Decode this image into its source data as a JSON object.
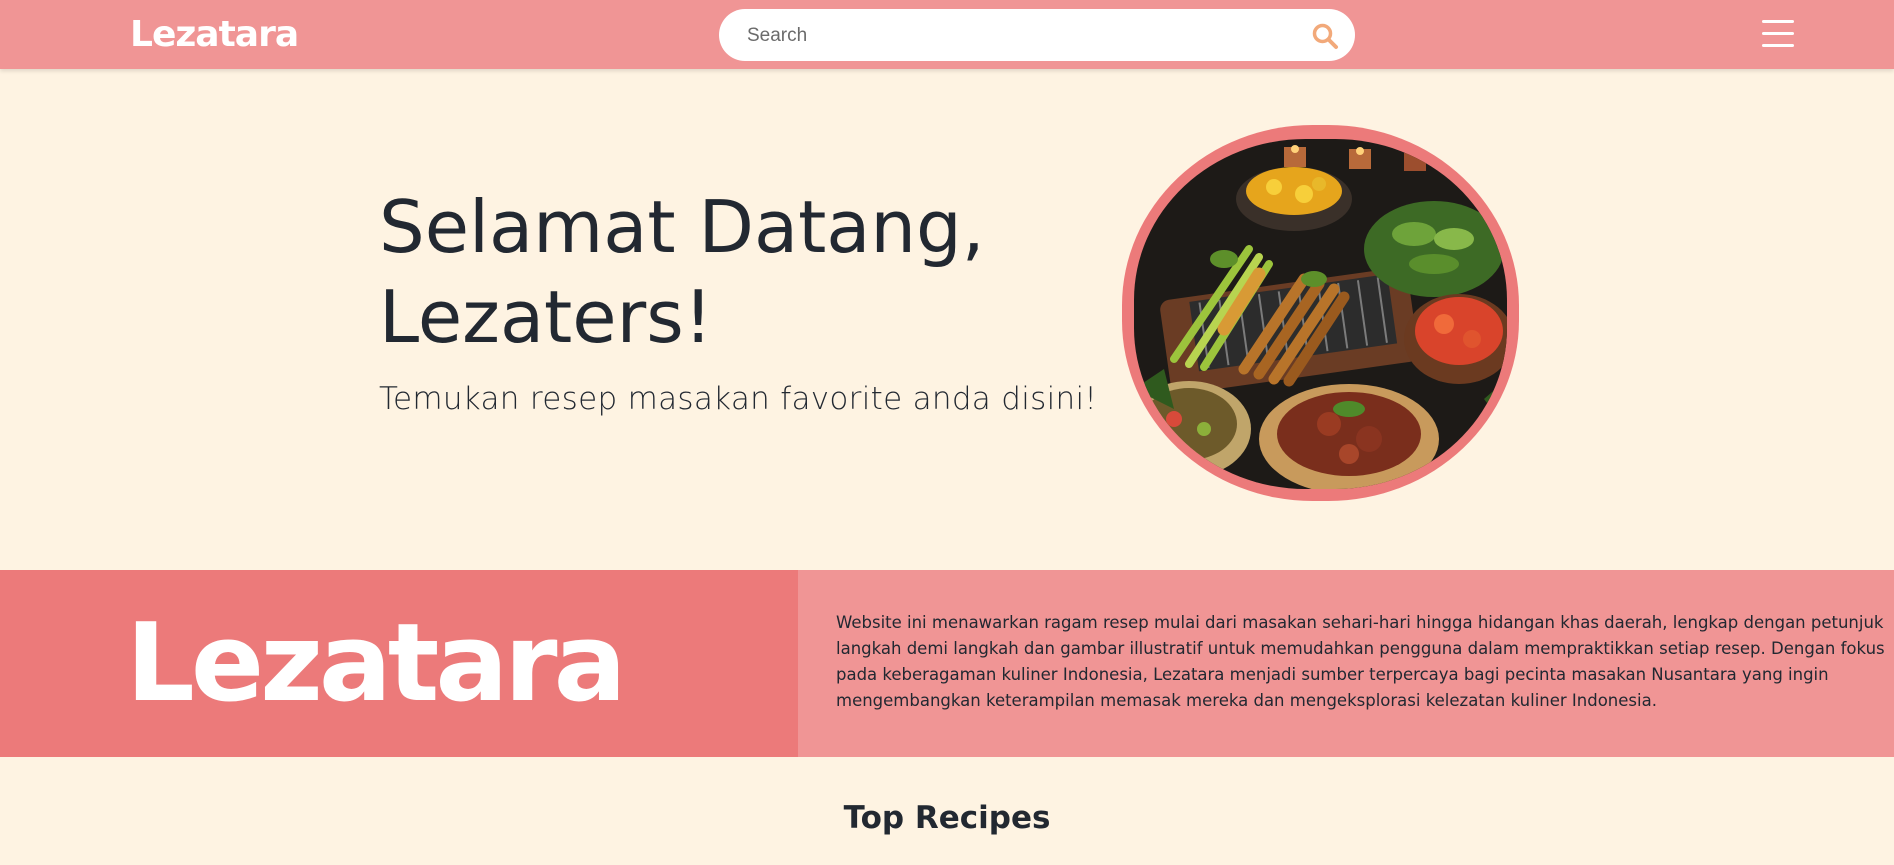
{
  "navbar": {
    "logo": "Lezatara",
    "search": {
      "placeholder": "Search",
      "value": ""
    },
    "search_icon": "search-icon",
    "menu_icon": "hamburger-menu-icon"
  },
  "hero": {
    "title_line1": "Selamat Datang,",
    "title_line2": "Lezaters!",
    "subtitle": "Temukan resep masakan favorite anda disini!",
    "image_alt": "Indonesian dishes with satay skewers"
  },
  "about": {
    "logo": "Lezatara",
    "text": "Website ini menawarkan ragam resep mulai dari masakan sehari-hari hingga hidangan khas daerah, lengkap dengan petunjuk langkah demi langkah dan gambar illustratif untuk memudahkan pengguna dalam mempraktikkan setiap resep. Dengan fokus pada keberagaman kuliner Indonesia, Lezatara menjadi sumber terpercaya bagi pecinta masakan Nusantara yang ingin mengembangkan keterampilan memasak mereka dan mengeksplorasi kelezatan kuliner Indonesia."
  },
  "top_recipes": {
    "title": "Top Recipes"
  },
  "colors": {
    "navbar": "#f09595",
    "accent": "#ec7a7a",
    "background": "#fef3e2",
    "text": "#222831",
    "search_icon": "#f2a97a"
  }
}
